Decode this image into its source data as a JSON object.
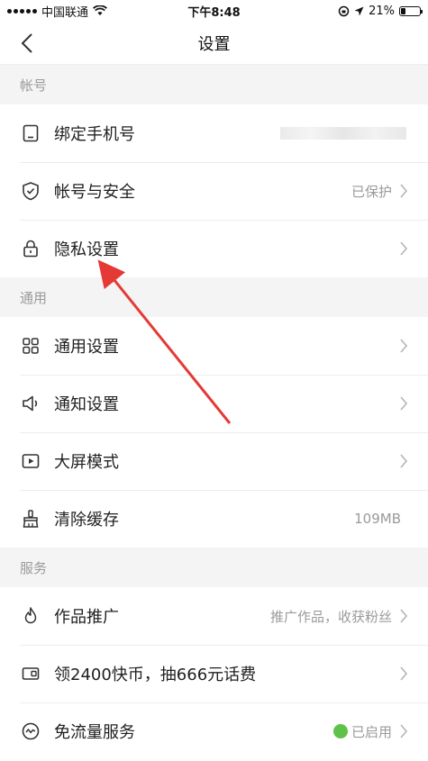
{
  "status_bar": {
    "carrier": "中国联通",
    "time": "下午8:48",
    "battery": "21%"
  },
  "nav": {
    "title": "设置"
  },
  "sections": [
    {
      "header": "帐号",
      "rows": [
        {
          "label": "绑定手机号",
          "value": ""
        },
        {
          "label": "帐号与安全",
          "value": "已保护"
        },
        {
          "label": "隐私设置",
          "value": ""
        }
      ]
    },
    {
      "header": "通用",
      "rows": [
        {
          "label": "通用设置",
          "value": ""
        },
        {
          "label": "通知设置",
          "value": ""
        },
        {
          "label": "大屏模式",
          "value": ""
        },
        {
          "label": "清除缓存",
          "value": "109MB"
        }
      ]
    },
    {
      "header": "服务",
      "rows": [
        {
          "label": "作品推广",
          "value": "推广作品，收获粉丝"
        },
        {
          "label": "领2400快币，抽666元话费",
          "value": ""
        },
        {
          "label": "免流量服务",
          "value": "已启用"
        }
      ]
    }
  ],
  "colors": {
    "annotation_arrow": "#e53935",
    "enabled_dot": "#5ec24a"
  },
  "icons": [
    "phone-icon",
    "shield-icon",
    "lock-icon",
    "grid-icon",
    "speaker-icon",
    "play-icon",
    "brush-icon",
    "flame-icon",
    "coupon-icon",
    "wave-icon",
    "chevron-right-icon"
  ]
}
